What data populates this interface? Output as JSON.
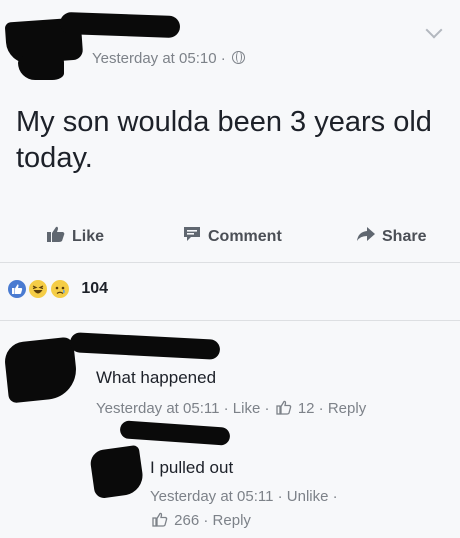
{
  "post": {
    "timestamp": "Yesterday at 05:10 ·",
    "text": "My son woulda been 3 years old today."
  },
  "actions": {
    "like": "Like",
    "comment": "Comment",
    "share": "Share"
  },
  "reactions": {
    "count": "104"
  },
  "comments": [
    {
      "text": "What happened",
      "time": "Yesterday at 05:11 ·",
      "like": "Like",
      "sep": "·",
      "likes": "12",
      "sep2": "·",
      "reply": "Reply"
    },
    {
      "text": "I pulled out",
      "time": "Yesterday at 05:11 ·",
      "unlike": "Unlike ·",
      "likes": "266",
      "sep": "·",
      "reply": "Reply"
    }
  ],
  "colors": {
    "meta": "#7d8289",
    "action": "#4b4f56",
    "like_blue": "#4a7bd1",
    "redaction": "#0a0a0a"
  },
  "icons": [
    "globe-icon",
    "chevron-down-icon",
    "thumbs-up-icon",
    "comment-icon",
    "share-arrow-icon",
    "like-reaction-icon",
    "haha-reaction-icon",
    "sad-reaction-icon"
  ]
}
